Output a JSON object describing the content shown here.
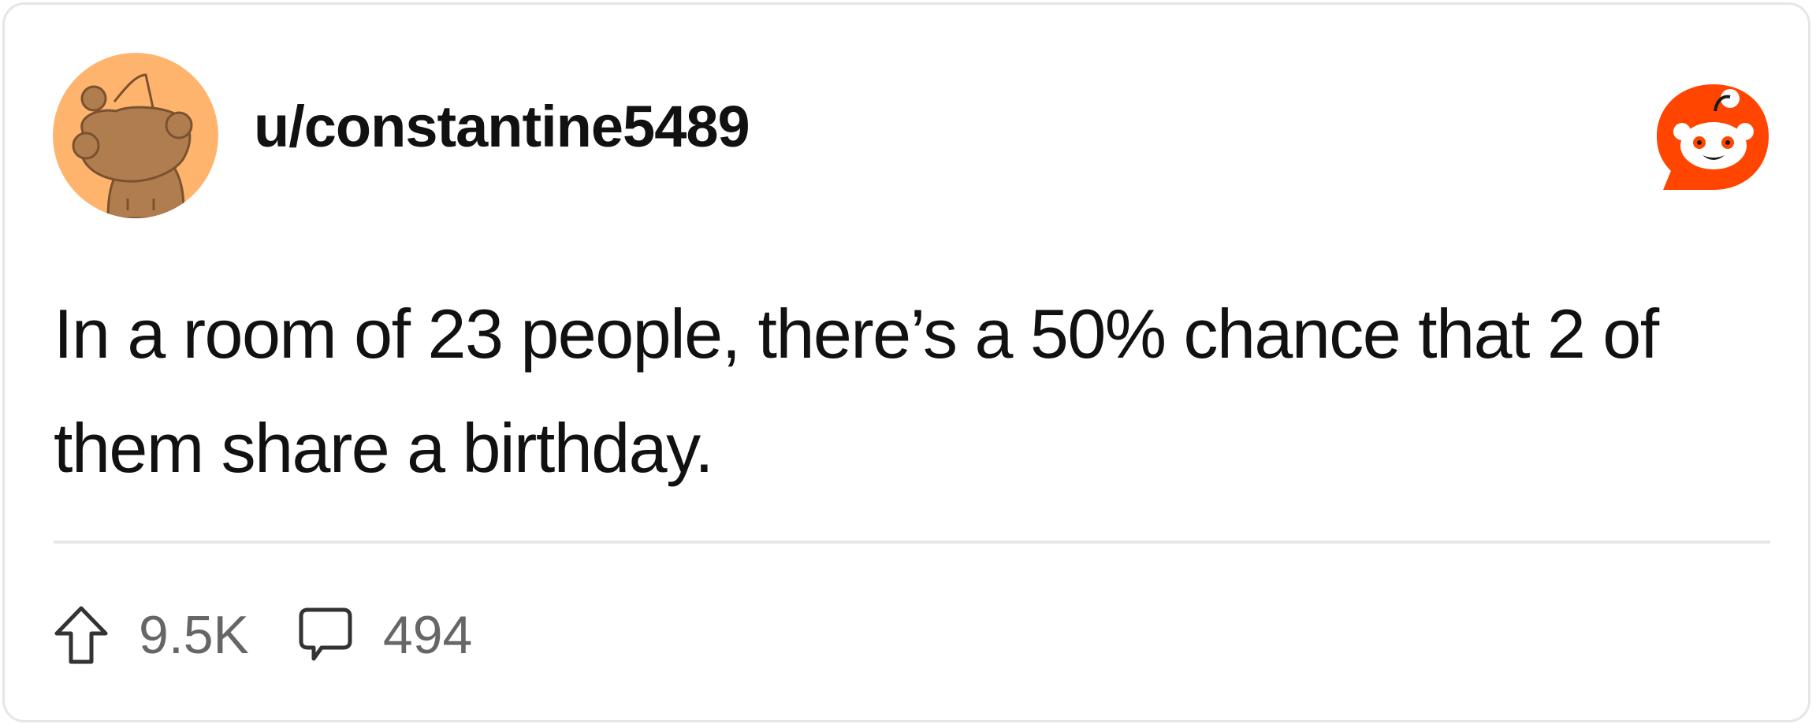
{
  "post": {
    "username": "u/constantine5489",
    "text": "In a room of 23 people, there’s a 50% chance that 2 of them share a birthday.",
    "upvotes": "9.5K",
    "comments": "494"
  },
  "icons": {
    "avatar": "snoo-avatar-icon",
    "logo": "reddit-logo-icon",
    "upvote": "upvote-arrow-icon",
    "comment": "comment-bubble-icon"
  },
  "colors": {
    "avatar_bg": "#ffb46e",
    "avatar_figure": "#b07d4f",
    "reddit_orange": "#ff4500",
    "text": "#111111",
    "muted": "#666666",
    "divider": "#e8e8e8"
  }
}
